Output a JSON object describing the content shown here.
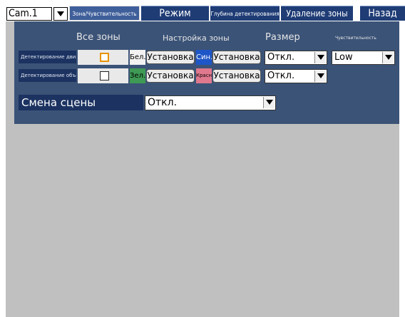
{
  "camera": {
    "selected": "Cam.1"
  },
  "tabs": [
    {
      "label": "Зона/Чувствительность",
      "active": true
    },
    {
      "label": "Режим",
      "active": false
    },
    {
      "label": "Глубина детектирования",
      "active": false
    },
    {
      "label": "Удаление зоны",
      "active": false
    },
    {
      "label": "Назад",
      "active": false
    }
  ],
  "headers": {
    "all_zones": "Все зоны",
    "zone_setup": "Настройка зоны",
    "size": "Размер",
    "sensitivity": "Чувствительность"
  },
  "rows": [
    {
      "label": "Детектирование движения",
      "checkbox_checked": false,
      "zone1": {
        "color_label": "Бел.",
        "color": "#f2f2f2",
        "button": "Установка"
      },
      "zone2": {
        "color_label": "Син.",
        "color": "#1e56c8",
        "button": "Установка"
      },
      "size": "Откл.",
      "sensitivity": "Low"
    },
    {
      "label": "Детектирование объекта",
      "checkbox_checked": false,
      "zone1": {
        "color_label": "Зел.",
        "color": "#3e9a55",
        "button": "Установка"
      },
      "zone2": {
        "color_label": "Красн.",
        "color": "#e0788e",
        "button": "Установка"
      },
      "size": "Откл."
    }
  ],
  "scene_change": {
    "label": "Смена сцены",
    "value": "Откл."
  },
  "colors": {
    "panel_bg": "#3b5377",
    "label_bg": "#1c3361",
    "tab_bg": "#1f3c75",
    "focus_checkbox": "#e8920a",
    "screen_bg": "#c0c0c0"
  }
}
